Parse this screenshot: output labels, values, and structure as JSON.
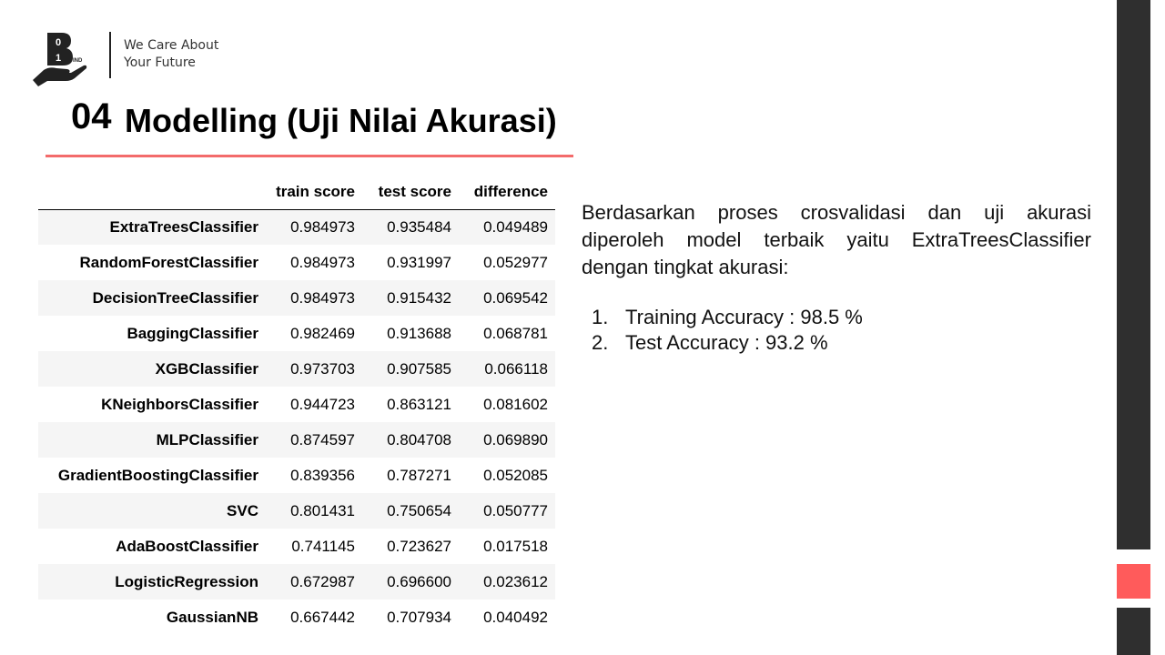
{
  "header": {
    "logo_digits_top": "0",
    "logo_digits_bottom": "1",
    "logo_suffix": "IND",
    "tagline_line1": "We Care About",
    "tagline_line2": "Your Future"
  },
  "title": {
    "number": "04",
    "text": "Modelling (Uji Nilai Akurasi)"
  },
  "table": {
    "columns": [
      "",
      "train score",
      "test score",
      "difference"
    ],
    "rows": [
      {
        "name": "ExtraTreesClassifier",
        "train": "0.984973",
        "test": "0.935484",
        "diff": "0.049489"
      },
      {
        "name": "RandomForestClassifier",
        "train": "0.984973",
        "test": "0.931997",
        "diff": "0.052977"
      },
      {
        "name": "DecisionTreeClassifier",
        "train": "0.984973",
        "test": "0.915432",
        "diff": "0.069542"
      },
      {
        "name": "BaggingClassifier",
        "train": "0.982469",
        "test": "0.913688",
        "diff": "0.068781"
      },
      {
        "name": "XGBClassifier",
        "train": "0.973703",
        "test": "0.907585",
        "diff": "0.066118"
      },
      {
        "name": "KNeighborsClassifier",
        "train": "0.944723",
        "test": "0.863121",
        "diff": "0.081602"
      },
      {
        "name": "MLPClassifier",
        "train": "0.874597",
        "test": "0.804708",
        "diff": "0.069890"
      },
      {
        "name": "GradientBoostingClassifier",
        "train": "0.839356",
        "test": "0.787271",
        "diff": "0.052085"
      },
      {
        "name": "SVC",
        "train": "0.801431",
        "test": "0.750654",
        "diff": "0.050777"
      },
      {
        "name": "AdaBoostClassifier",
        "train": "0.741145",
        "test": "0.723627",
        "diff": "0.017518"
      },
      {
        "name": "LogisticRegression",
        "train": "0.672987",
        "test": "0.696600",
        "diff": "0.023612"
      },
      {
        "name": "GaussianNB",
        "train": "0.667442",
        "test": "0.707934",
        "diff": "0.040492"
      }
    ]
  },
  "summary": {
    "paragraph": "Berdasarkan proses crosvalidasi dan uji akurasi diperoleh model terbaik yaitu ExtraTreesClassifier dengan tingkat akurasi:",
    "items": [
      {
        "num": "1.",
        "text": "Training Accuracy : 98.5 %"
      },
      {
        "num": "2.",
        "text": "Test Accuracy : 93.2 %"
      }
    ]
  },
  "colors": {
    "accent_red": "#ff5b5b",
    "underline_red": "#f36b6b",
    "bar_dark": "#2f2f2f"
  }
}
